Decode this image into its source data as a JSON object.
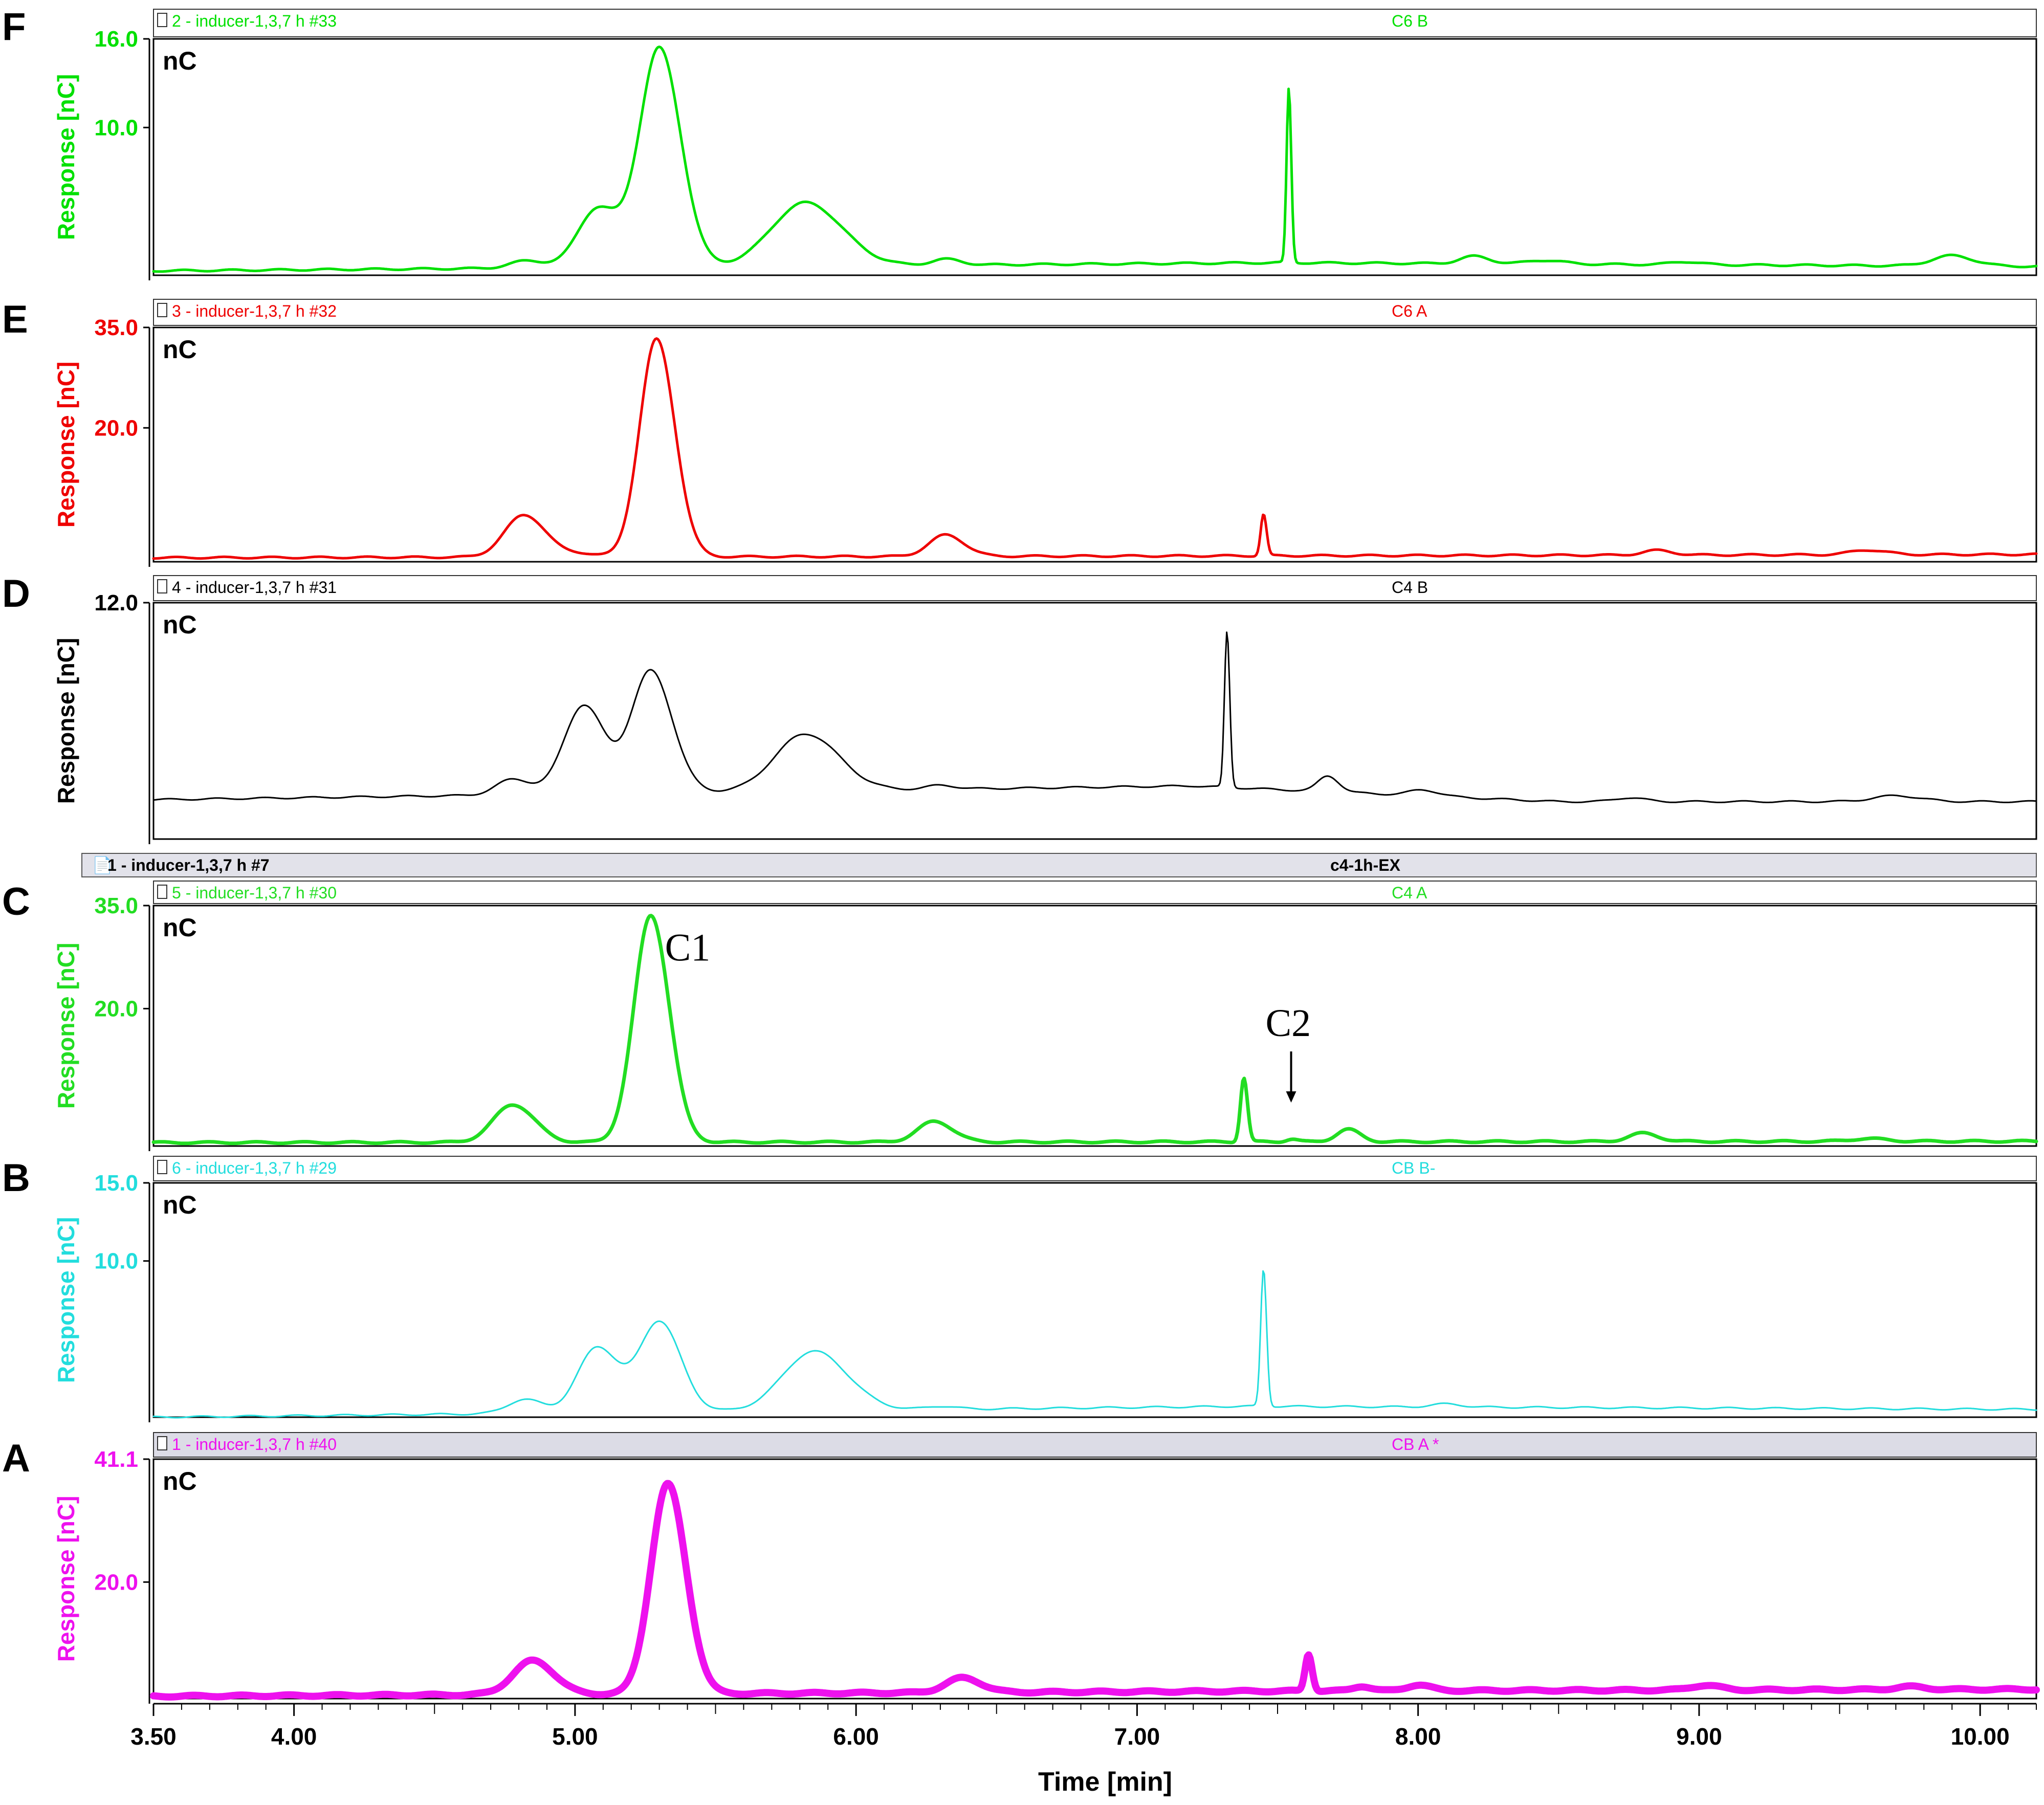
{
  "figure": {
    "x_axis_title": "Time [min]",
    "x_ticks": [
      3.5,
      4.0,
      5.0,
      6.0,
      7.0,
      8.0,
      9.0,
      10.0
    ],
    "x_tick_labels": [
      "3.50",
      "4.00",
      "5.00",
      "6.00",
      "7.00",
      "8.00",
      "9.00",
      "10.00"
    ],
    "shared_header": {
      "left": "1 - inducer-1,3,7 h #7",
      "right": "c4-1h-EX"
    },
    "annotations": [
      {
        "text": "C1",
        "x": 5.32,
        "y": 27,
        "panel": "C"
      },
      {
        "text": "C2",
        "x": 7.53,
        "y": 16,
        "panel": "C",
        "arrow": true
      }
    ]
  },
  "chart_data": [
    {
      "panel": "F",
      "type": "line",
      "color": "#00e000",
      "header_left": "2 - inducer-1,3,7 h #33",
      "header_right": "C6 B",
      "unit_label": "nC",
      "ylabel": "Response [nC]",
      "ytick_values": [
        10.0,
        16.0
      ],
      "ytick_labels": [
        "10.0",
        "16.0"
      ],
      "ylim": [
        0,
        16
      ],
      "xlim": [
        3.5,
        10.2
      ],
      "baseline": [
        [
          3.5,
          0.3
        ],
        [
          7.5,
          0.85
        ],
        [
          10.2,
          0.6
        ]
      ],
      "peaks": [
        [
          4.83,
          0.5,
          0.06
        ],
        [
          5.08,
          4.0,
          0.07
        ],
        [
          5.3,
          14.8,
          0.07
        ],
        [
          5.82,
          4.3,
          0.12
        ],
        [
          6.32,
          0.4,
          0.05
        ],
        [
          7.54,
          11.8,
          0.008
        ],
        [
          8.2,
          0.5,
          0.05
        ],
        [
          8.45,
          0.25,
          0.06
        ],
        [
          8.95,
          0.2,
          0.05
        ],
        [
          9.9,
          0.7,
          0.07
        ]
      ],
      "line_width": 5
    },
    {
      "panel": "E",
      "type": "line",
      "color": "#ee0000",
      "header_left": "3 - inducer-1,3,7 h #32",
      "header_right": "C6 A",
      "unit_label": "nC",
      "ylabel": "Response [nC]",
      "ytick_values": [
        20.0,
        35.0
      ],
      "ytick_labels": [
        "20.0",
        "35.0"
      ],
      "ylim": [
        0,
        35
      ],
      "xlim": [
        3.5,
        10.2
      ],
      "baseline": [
        [
          3.5,
          0.6
        ],
        [
          10.2,
          1.1
        ]
      ],
      "peaks": [
        [
          4.82,
          6.3,
          0.07
        ],
        [
          5.02,
          0.5,
          0.05
        ],
        [
          5.29,
          32.5,
          0.06
        ],
        [
          6.32,
          3.2,
          0.06
        ],
        [
          7.45,
          6.2,
          0.01
        ],
        [
          8.85,
          0.7,
          0.05
        ],
        [
          9.6,
          0.7,
          0.06
        ]
      ],
      "line_width": 5
    },
    {
      "panel": "D",
      "type": "line",
      "color": "#000000",
      "header_left": "4 - inducer-1,3,7 h #31",
      "header_right": "C4 B",
      "unit_label": "nC",
      "ylabel": "Response [nC]",
      "ytick_values": [
        12.0
      ],
      "ytick_labels": [
        "12.0"
      ],
      "ylim": [
        0,
        12
      ],
      "xlim": [
        3.5,
        10.2
      ],
      "baseline": [
        [
          3.5,
          2.0
        ],
        [
          7.2,
          2.7
        ],
        [
          8.5,
          1.9
        ],
        [
          10.2,
          1.9
        ]
      ],
      "peaks": [
        [
          4.78,
          0.8,
          0.06
        ],
        [
          5.03,
          4.5,
          0.07
        ],
        [
          5.27,
          6.2,
          0.07
        ],
        [
          5.82,
          2.9,
          0.11
        ],
        [
          6.3,
          0.2,
          0.05
        ],
        [
          7.32,
          7.9,
          0.009
        ],
        [
          7.68,
          0.8,
          0.035
        ],
        [
          8.02,
          0.3,
          0.05
        ],
        [
          8.75,
          0.2,
          0.05
        ],
        [
          9.7,
          0.3,
          0.08
        ]
      ],
      "line_width": 3
    },
    {
      "panel": "C",
      "type": "line",
      "color": "#22dd22",
      "header_left": "5 - inducer-1,3,7 h #30",
      "header_right": "C4 A",
      "unit_label": "nC",
      "ylabel": "Response [nC]",
      "ytick_values": [
        20.0,
        35.0
      ],
      "ytick_labels": [
        "20.0",
        "35.0"
      ],
      "ylim": [
        0,
        35
      ],
      "xlim": [
        3.5,
        10.2
      ],
      "baseline": [
        [
          3.5,
          0.5
        ],
        [
          10.2,
          0.7
        ]
      ],
      "peaks": [
        [
          4.78,
          5.5,
          0.07
        ],
        [
          5.27,
          33.0,
          0.06
        ],
        [
          6.28,
          3.0,
          0.06
        ],
        [
          7.38,
          9.3,
          0.012
        ],
        [
          7.55,
          0.4,
          0.02
        ],
        [
          7.75,
          1.8,
          0.04
        ],
        [
          8.8,
          1.2,
          0.05
        ],
        [
          9.6,
          0.4,
          0.06
        ]
      ],
      "line_width": 7
    },
    {
      "panel": "B",
      "type": "line",
      "color": "#22dddd",
      "header_left": "6 - inducer-1,3,7 h #29",
      "header_right": "CB B-",
      "unit_label": "nC",
      "ylabel": "Response [nC]",
      "ytick_values": [
        10.0,
        15.0
      ],
      "ytick_labels": [
        "10.0",
        "15.0"
      ],
      "ylim": [
        0,
        15
      ],
      "xlim": [
        3.5,
        10.2
      ],
      "baseline": [
        [
          3.5,
          0.0
        ],
        [
          7.4,
          0.7
        ],
        [
          10.2,
          0.5
        ]
      ],
      "peaks": [
        [
          4.82,
          0.9,
          0.06
        ],
        [
          5.08,
          4.2,
          0.07
        ],
        [
          5.3,
          5.8,
          0.07
        ],
        [
          5.85,
          3.8,
          0.11
        ],
        [
          6.3,
          0.2,
          0.05
        ],
        [
          7.45,
          8.8,
          0.01
        ],
        [
          8.1,
          0.2,
          0.05
        ]
      ],
      "line_width": 3
    },
    {
      "panel": "A",
      "type": "line",
      "color": "#ee11ee",
      "header_left": "1 - inducer-1,3,7 h #40",
      "header_right": "CB A *",
      "unit_label": "nC",
      "ylabel": "Response [nC]",
      "ytick_values": [
        20.0,
        41.1
      ],
      "ytick_labels": [
        "20.0",
        "41.1"
      ],
      "ylim": [
        0,
        41.1
      ],
      "xlim": [
        3.5,
        10.2
      ],
      "baseline": [
        [
          3.5,
          0.4
        ],
        [
          7.5,
          1.3
        ],
        [
          10.2,
          1.6
        ]
      ],
      "peaks": [
        [
          4.85,
          5.8,
          0.07
        ],
        [
          5.33,
          36.0,
          0.06
        ],
        [
          6.38,
          2.5,
          0.06
        ],
        [
          7.61,
          6.3,
          0.012
        ],
        [
          7.8,
          0.8,
          0.03
        ],
        [
          8.0,
          1.0,
          0.04
        ],
        [
          9.02,
          0.8,
          0.05
        ],
        [
          9.75,
          0.5,
          0.05
        ]
      ],
      "line_width": 14
    }
  ]
}
